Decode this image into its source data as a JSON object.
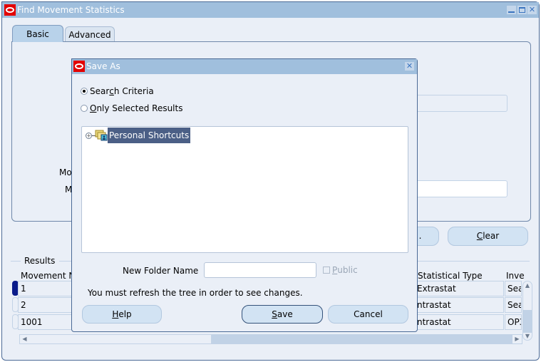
{
  "main_window": {
    "title": "Find  Movement Statistics",
    "controls": {
      "minimize": "minimize",
      "maximize": "maximize",
      "close": "✕"
    }
  },
  "tabs": [
    {
      "label": "Basic",
      "active": true
    },
    {
      "label": "Advanced",
      "active": false
    }
  ],
  "basic_panel": {
    "labels": [
      "Mo",
      "M"
    ]
  },
  "buttons": {
    "clear_label": "Clear",
    "clear_mnemonic": "C",
    "hidden_button_tail": "."
  },
  "results": {
    "legend": "Results",
    "columns": [
      "Movement N",
      "Statistical Type",
      "Inve"
    ],
    "rows": [
      {
        "movement": "1",
        "stat_type": "Extrastat",
        "inv": "Sea",
        "current": true
      },
      {
        "movement": "2",
        "stat_type": "ntrastat",
        "inv": "Sea",
        "current": false
      },
      {
        "movement": "1001",
        "stat_type": "ntrastat",
        "inv": "OP3",
        "current": false
      }
    ]
  },
  "dialog": {
    "title": "Save As",
    "close": "✕",
    "options": [
      {
        "label_pre": "Sear",
        "mnemonic": "c",
        "label_post": "h Criteria",
        "selected": true
      },
      {
        "label_pre": "",
        "mnemonic": "O",
        "label_post": "nly Selected Results",
        "selected": false
      }
    ],
    "tree": {
      "nodes": [
        {
          "label": "Personal Shortcuts",
          "selected": true,
          "expanded": false
        }
      ]
    },
    "new_folder_label": "New Folder Name",
    "new_folder_value": "",
    "public": {
      "mnemonic": "P",
      "rest": "ublic",
      "checked": false,
      "enabled": false
    },
    "refresh_note": "You must refresh the tree in order to see changes.",
    "help": {
      "mnemonic": "H",
      "rest": "elp"
    },
    "save": {
      "mnemonic": "S",
      "rest": "ave"
    },
    "cancel_label": "Cancel"
  },
  "colors": {
    "title_bar": "#a0bfdd",
    "window_bg": "#eaeff7",
    "oracle_red": "#e30000",
    "selection": "#4b5f86",
    "current_record": "#0a1b8a"
  }
}
